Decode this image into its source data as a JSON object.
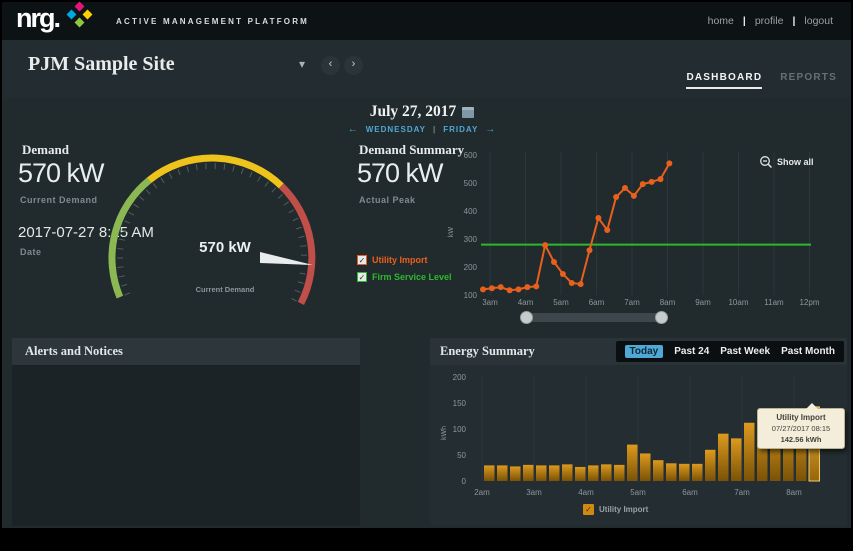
{
  "header": {
    "logo_text": "nrg.",
    "platform_title": "ACTIVE MANAGEMENT PLATFORM",
    "nav": [
      "home",
      "profile",
      "logout"
    ],
    "separator": "|"
  },
  "site_bar": {
    "site_name": "PJM Sample Site",
    "tabs": [
      {
        "label": "DASHBOARD",
        "active": true
      },
      {
        "label": "REPORTS",
        "active": false
      }
    ]
  },
  "date_nav": {
    "date": "July 27, 2017",
    "prev_day": "WEDNESDAY",
    "next_day": "FRIDAY",
    "separator": "|"
  },
  "icons": {
    "check": "✓",
    "dropdown": "▾",
    "prev": "‹",
    "next": "›",
    "left_arrow": "←",
    "right_arrow": "→"
  },
  "demand": {
    "title": "Demand",
    "current_value": "570 kW",
    "current_label": "Current Demand",
    "date_value": "2017-07-27 8:15 AM",
    "date_label": "Date",
    "gauge_value": "570 kW",
    "gauge_label": "Current Demand"
  },
  "demand_summary": {
    "title": "Demand Summary",
    "peak_value": "570 kW",
    "peak_label": "Actual Peak",
    "show_all": "Show all",
    "ylabel": "kW",
    "legend": [
      {
        "label": "Utility Import",
        "color": "#e8601d"
      },
      {
        "label": "Firm Service Level",
        "color": "#2db92d"
      }
    ]
  },
  "alerts": {
    "title": "Alerts and Notices"
  },
  "energy_summary": {
    "title": "Energy Summary",
    "buttons": [
      "Today",
      "Past 24",
      "Past Week",
      "Past Month"
    ],
    "active_button": "Today",
    "ylabel": "kWh",
    "legend_label": "Utility Import",
    "tooltip": {
      "title": "Utility Import",
      "datetime": "07/27/2017 08:15",
      "value": "142.56 kWh"
    }
  },
  "colors": {
    "blue": "#4fa8d5",
    "orange": "#e8601d",
    "green": "#2db92d",
    "bar_top": "#dd9a1e",
    "bar_bottom": "#7a5206",
    "bar_hi_top": "#f2b63e",
    "bar_hi_bottom": "#96660a",
    "bar_hi_stroke": "#f3c96b",
    "gauge_green": "#8cb853",
    "gauge_yellow": "#eec41c",
    "gauge_red": "#bf4f48",
    "legend_checkbox_amber": "#cf8a10",
    "logo_star": [
      "#e5157a",
      "#00a7e1",
      "#ffd100",
      "#8dc63f"
    ]
  },
  "chart_data": [
    {
      "type": "line",
      "title": "Demand Summary",
      "ylabel": "kW",
      "ylim": [
        100,
        600
      ],
      "yticks": [
        100,
        200,
        300,
        400,
        500,
        600
      ],
      "xticks": [
        "3am",
        "4am",
        "5am",
        "6am",
        "7am",
        "8am",
        "9am",
        "10am",
        "11am",
        "12pm"
      ],
      "firm_service_level": 280,
      "grid": "vertical",
      "series": [
        {
          "name": "Utility Import",
          "times": [
            "3:00",
            "3:15",
            "3:30",
            "3:45",
            "4:00",
            "4:15",
            "4:30",
            "4:45",
            "5:00",
            "5:15",
            "5:30",
            "5:45",
            "6:00",
            "6:15",
            "6:30",
            "6:45",
            "7:00",
            "7:15",
            "7:30",
            "7:45",
            "8:00",
            "8:15"
          ],
          "values": [
            120,
            124,
            128,
            117,
            120,
            128,
            131,
            278,
            218,
            175,
            143,
            139,
            260,
            375,
            332,
            450,
            482,
            454,
            496,
            504,
            514,
            570
          ]
        },
        {
          "name": "Firm Service Level",
          "values": "constant 280"
        }
      ]
    },
    {
      "type": "bar",
      "title": "Energy Summary",
      "ylabel": "kWh",
      "ylim": [
        0,
        200
      ],
      "yticks": [
        0,
        50,
        100,
        150,
        200
      ],
      "xticks": [
        "2am",
        "3am",
        "4am",
        "5am",
        "6am",
        "7am",
        "8am"
      ],
      "grid": "vertical",
      "highlighted_bar_index": 25,
      "series": [
        {
          "name": "Utility Import",
          "times": [
            "2:00",
            "2:15",
            "2:30",
            "2:45",
            "3:00",
            "3:15",
            "3:30",
            "3:45",
            "4:00",
            "4:15",
            "4:30",
            "4:45",
            "5:00",
            "5:15",
            "5:30",
            "5:45",
            "6:00",
            "6:15",
            "6:30",
            "6:45",
            "7:00",
            "7:15",
            "7:30",
            "7:45",
            "8:00",
            "8:15"
          ],
          "values": [
            30,
            30,
            28,
            31,
            30,
            30,
            32,
            27,
            30,
            32,
            31,
            70,
            53,
            40,
            34,
            33,
            33,
            60,
            91,
            82,
            112,
            120,
            113,
            118,
            125,
            142.56
          ]
        }
      ]
    }
  ]
}
